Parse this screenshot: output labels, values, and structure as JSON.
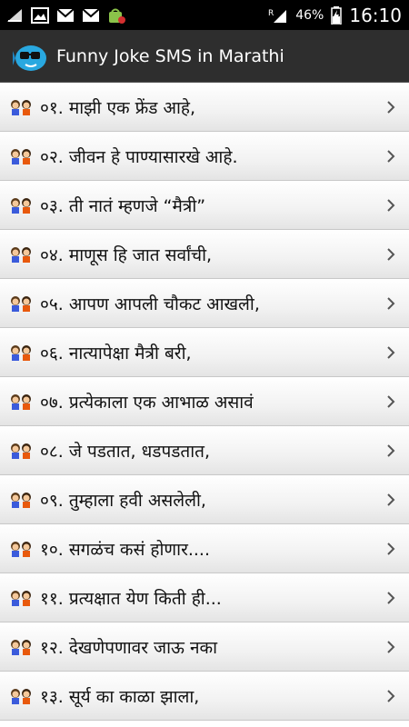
{
  "status_bar": {
    "battery_percent": "46%",
    "time": "16:10",
    "notification_icons": [
      "charging-icon",
      "gallery-icon",
      "gmail-icon",
      "gmail-icon",
      "android-store-icon"
    ],
    "status_icons": [
      "sim-roaming-icon",
      "signal-icon",
      "battery-icon"
    ]
  },
  "action_bar": {
    "title": "Funny Joke SMS in Marathi",
    "app_icon": "fish-with-glasses-icon"
  },
  "list": {
    "items": [
      {
        "label": "०१. माझी एक फ्रेंड आहे,"
      },
      {
        "label": "०२. जीवन हे पाण्यासारखे आहे."
      },
      {
        "label": "०३. ती नातं म्हणजे “मैत्री”"
      },
      {
        "label": "०४. माणूस हि जात सर्वांची,"
      },
      {
        "label": "०५. आपण आपली चौकट आखली,"
      },
      {
        "label": "०६. नात्यापेक्षा मैत्री बरी,"
      },
      {
        "label": "०७. प्रत्येकाला एक आभाळ असावं"
      },
      {
        "label": "०८. जे पडतात, धडपडतात,"
      },
      {
        "label": "०९. तुम्हाला हवी असलेली,"
      },
      {
        "label": "१०. सगळंच कसं होणार...."
      },
      {
        "label": "११. प्रत्यक्षात येण किती ही..."
      },
      {
        "label": "१२. देखणेपणावर जाऊ नका"
      },
      {
        "label": "१३. सूर्य का काळा झाला,"
      }
    ],
    "item_icon": "two-kids-icon",
    "chevron_icon": "chevron-right-icon"
  }
}
